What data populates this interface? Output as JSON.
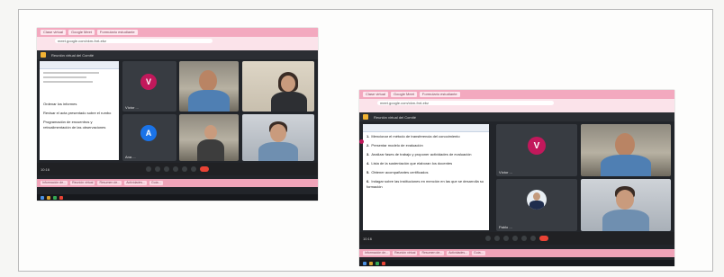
{
  "left": {
    "tabs": [
      "Clase virtual",
      "Google Meet",
      "Formulario estudiante"
    ],
    "url": "meet.google.com/xkm-fnrt-ebz",
    "meeting_title": "Reunión virtual del Comité",
    "doc_items": [
      "Ordenar los informes",
      "Revisar el acta presentado sobre el rumbo",
      "Programación de encuentros y retroalimentación de las observaciones"
    ],
    "tiles": {
      "v_initial": "V",
      "v_name": "Víctor ...",
      "a_initial": "A",
      "a_name": "Ana ..."
    },
    "time": "10:16",
    "taskbar": [
      "Información de...",
      "Reunión virtual",
      "Resumen de...",
      "Actividades...",
      "Guía..."
    ]
  },
  "right": {
    "tabs": [
      "Clase virtual",
      "Google Meet",
      "Formulario estudiante"
    ],
    "url": "meet.google.com/xkm-fnrt-ebz",
    "meeting_title": "Reunión virtual del Comité",
    "doc_items": [
      {
        "num": "1.",
        "text": "Mencionar el método de transferencia del conocimiento"
      },
      {
        "num": "2.",
        "text": "Presentar modelo de evaluación"
      },
      {
        "num": "3.",
        "text": "Analizar fases de trabajo y proponer actividades de evaluación"
      },
      {
        "num": "4.",
        "text": "Lista de la sustentación que elaboran los docentes"
      },
      {
        "num": "5.",
        "text": "Obtener acompañantes certificados"
      },
      {
        "num": "6.",
        "text": "Indagar sobre las instituciones en mención en las que se desarrolla su formación"
      }
    ],
    "tiles": {
      "v_initial": "V",
      "v_name": "Víctor ...",
      "p_name": "Pablo ..."
    },
    "time": "10:16",
    "taskbar": [
      "Información de...",
      "Reunión virtual",
      "Resumen de...",
      "Actividades...",
      "Guía..."
    ]
  }
}
